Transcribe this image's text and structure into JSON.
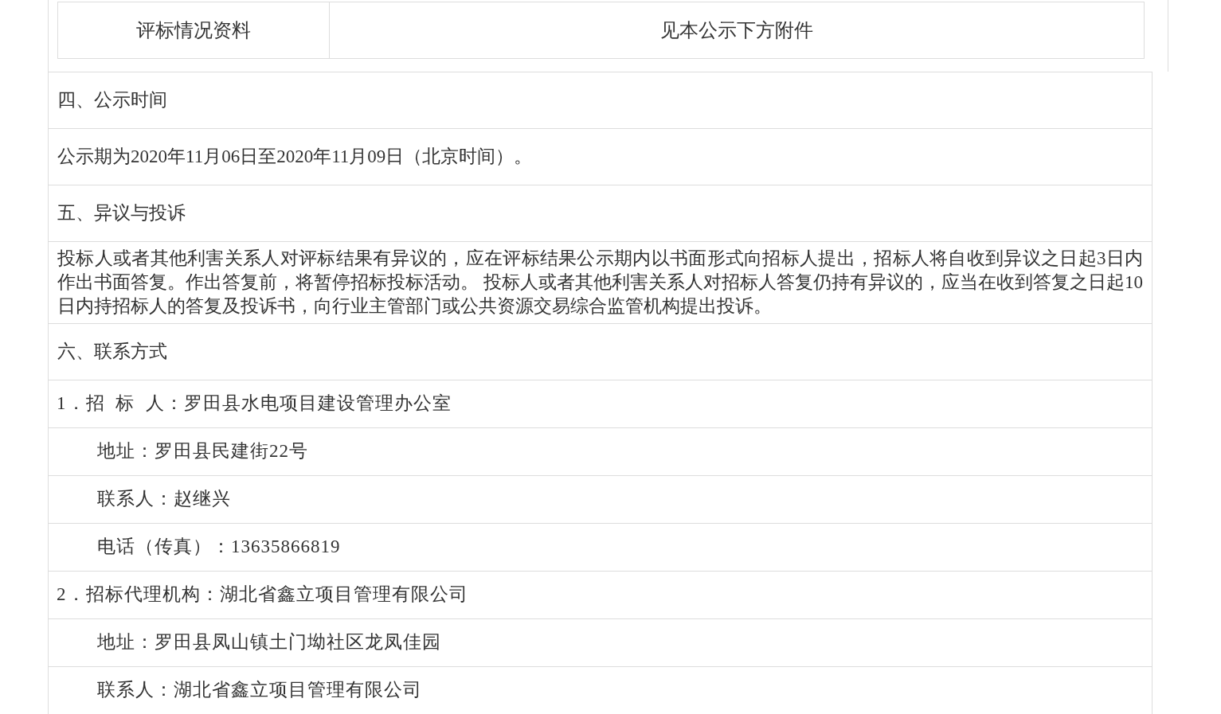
{
  "summary_table": {
    "rows": [
      {
        "label": "评标情况资料",
        "value": "见本公示下方附件"
      }
    ]
  },
  "sections": [
    {
      "kind": "line",
      "text": "四、公示时间"
    },
    {
      "kind": "line",
      "text": "公示期为2020年11月06日至2020年11月09日（北京时间）。"
    },
    {
      "kind": "line",
      "text": "五、异议与投诉"
    },
    {
      "kind": "paragraph",
      "text": "投标人或者其他利害关系人对评标结果有异议的，应在评标结果公示期内以书面形式向招标人提出，招标人将自收到异议之日起3日内作出书面答复。作出答复前，将暂停招标投标活动。 投标人或者其他利害关系人对招标人答复仍持有异议的，应当在收到答复之日起10日内持招标人的答复及投诉书，向行业主管部门或公共资源交易综合监管机构提出投诉。"
    },
    {
      "kind": "line",
      "text": "六、联系方式"
    },
    {
      "kind": "item",
      "text": "1．招  标  人：罗田县水电项目建设管理办公室"
    },
    {
      "kind": "indented",
      "text": "地址：罗田县民建街22号"
    },
    {
      "kind": "indented",
      "text": "联系人：赵继兴"
    },
    {
      "kind": "indented",
      "text": "电话（传真）：13635866819"
    },
    {
      "kind": "item",
      "text": "2．招标代理机构：湖北省鑫立项目管理有限公司"
    },
    {
      "kind": "indented",
      "text": "地址：罗田县凤山镇土门坳社区龙凤佳园"
    },
    {
      "kind": "indented",
      "text": "联系人：湖北省鑫立项目管理有限公司"
    }
  ]
}
